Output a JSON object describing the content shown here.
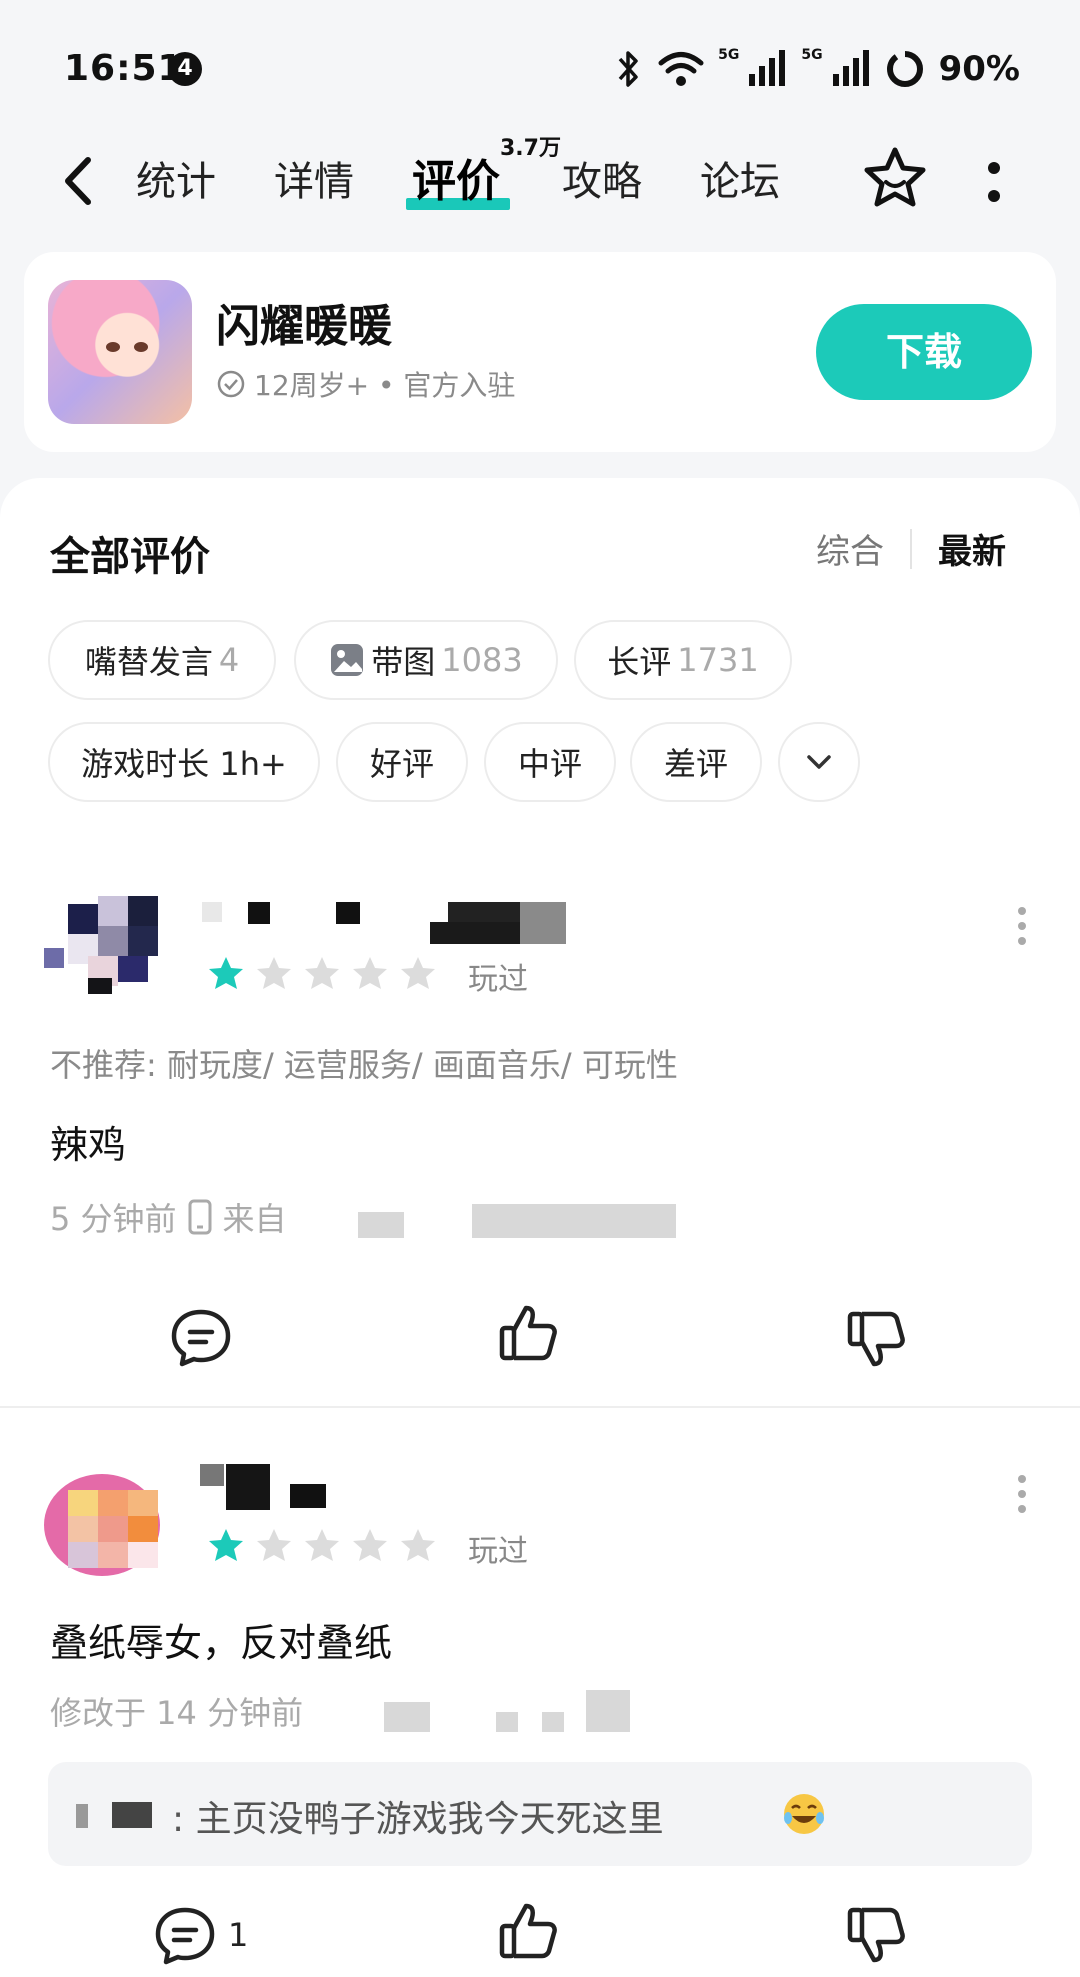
{
  "status_bar": {
    "time": "16:51",
    "notification_count": "4",
    "network_1": "5G",
    "network_2": "5G",
    "battery": "90%"
  },
  "nav": {
    "tabs": [
      "统计",
      "详情",
      "评价",
      "攻略",
      "论坛"
    ],
    "active_tab": "评价",
    "review_count_badge": "3.7万"
  },
  "app": {
    "name": "闪耀暖暖",
    "meta": "12周岁+ • 官方入驻",
    "download_label": "下载"
  },
  "reviews_section": {
    "title": "全部评价",
    "sort_options": [
      "综合",
      "最新"
    ],
    "active_sort": "最新",
    "filters": [
      {
        "label": "嘴替发言",
        "count": "4"
      },
      {
        "label": "带图",
        "count": "1083",
        "icon": "image-icon"
      },
      {
        "label": "长评",
        "count": "1731"
      },
      {
        "label": "游戏时长 1h+",
        "count": ""
      },
      {
        "label": "好评",
        "count": ""
      },
      {
        "label": "中评",
        "count": ""
      },
      {
        "label": "差评",
        "count": ""
      }
    ]
  },
  "reviews": [
    {
      "rating": 1,
      "played_label": "玩过",
      "tags": "不推荐: 耐玩度/ 运营服务/ 画面音乐/ 可玩性",
      "text": "辣鸡",
      "time": "5 分钟前",
      "device_prefix": "来自",
      "comment_count": ""
    },
    {
      "rating": 1,
      "played_label": "玩过",
      "tags": "",
      "text": "叠纸辱女，反对叠纸",
      "time": "修改于 14 分钟前",
      "reply": ": 主页没鸭子游戏我今天死这里",
      "comment_count": "1"
    }
  ],
  "colors": {
    "accent": "#1ccab9",
    "star_filled": "#1ccab9",
    "star_empty": "#dcdcdc"
  }
}
